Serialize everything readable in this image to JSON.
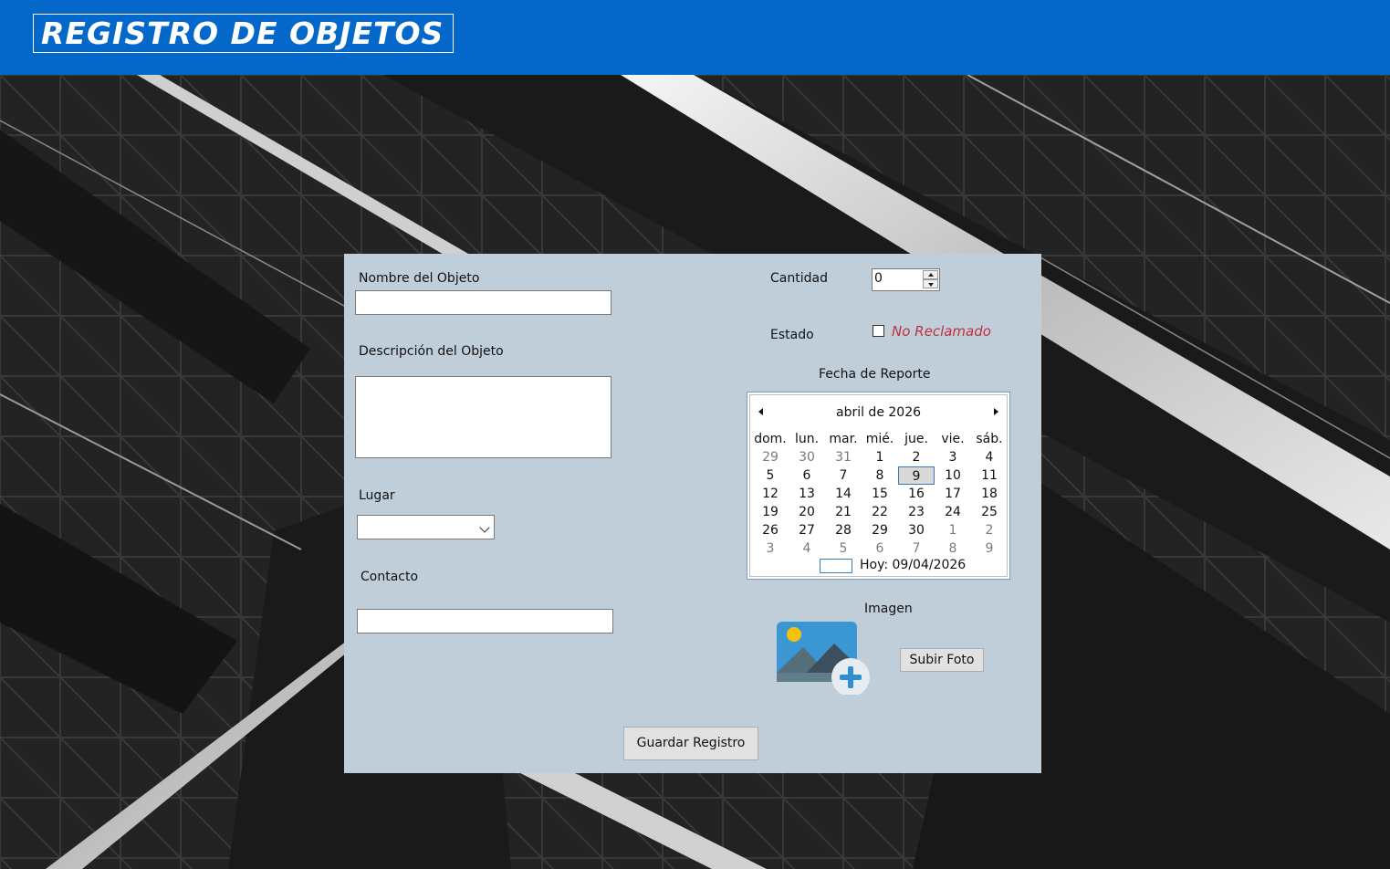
{
  "window": {
    "title": "REGISTRO DE OBJETOS"
  },
  "form": {
    "nombre_label": "Nombre del Objeto",
    "nombre_value": "",
    "descripcion_label": "Descripción del Objeto",
    "descripcion_value": "",
    "lugar_label": "Lugar",
    "lugar_selected": "",
    "contacto_label": "Contacto",
    "contacto_value": "",
    "cantidad_label": "Cantidad",
    "cantidad_value": "0",
    "estado_label": "Estado",
    "estado_checkbox_label": "No Reclamado",
    "estado_checked": false,
    "fecha_label": "Fecha de Reporte",
    "imagen_label": "Imagen",
    "subir_foto_label": "Subir Foto",
    "guardar_label": "Guardar Registro"
  },
  "calendar": {
    "month_title": "abril de 2026",
    "weekdays": [
      "dom.",
      "lun.",
      "mar.",
      "mié.",
      "jue.",
      "vie.",
      "sáb."
    ],
    "weeks": [
      [
        "29",
        "30",
        "31",
        "1",
        "2",
        "3",
        "4"
      ],
      [
        "5",
        "6",
        "7",
        "8",
        "9",
        "10",
        "11"
      ],
      [
        "12",
        "13",
        "14",
        "15",
        "16",
        "17",
        "18"
      ],
      [
        "19",
        "20",
        "21",
        "22",
        "23",
        "24",
        "25"
      ],
      [
        "26",
        "27",
        "28",
        "29",
        "30",
        "1",
        "2"
      ],
      [
        "3",
        "4",
        "5",
        "6",
        "7",
        "8",
        "9"
      ]
    ],
    "selected_day": "9",
    "today_text": "Hoy: 09/04/2026"
  },
  "icons": {
    "prev": "chevron-left-icon",
    "next": "chevron-right-icon",
    "dropdown": "chevron-down-icon",
    "image_placeholder": "image-add-icon"
  },
  "colors": {
    "header": "#0468cb",
    "panel": "#c0ceda",
    "status_text": "#c0313d",
    "selection_border": "#3a79b8"
  }
}
